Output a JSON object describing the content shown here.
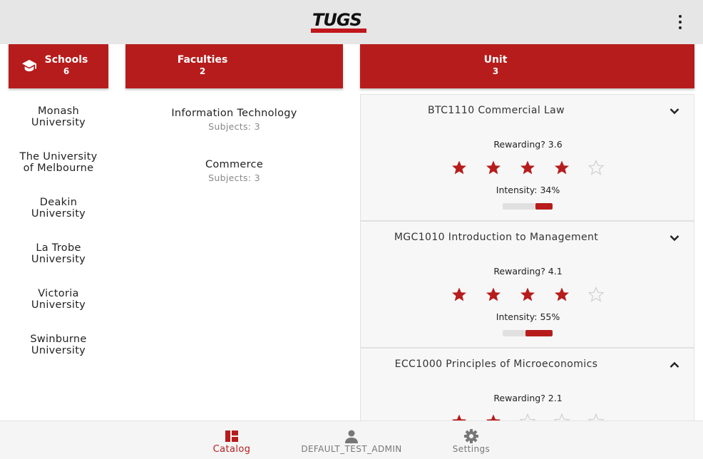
{
  "app": {
    "logo_text": "TUGS",
    "brand_color": "#b71c1c"
  },
  "header": {
    "menu_icon": "more-vertical-icon"
  },
  "columns": {
    "schools": {
      "title": "Schools",
      "count": "6",
      "icon": "graduation-cap-icon"
    },
    "faculties": {
      "title": "Faculties",
      "count": "2"
    },
    "unit": {
      "title": "Unit",
      "count": "3"
    }
  },
  "schools": [
    {
      "line1": "Monash",
      "line2": "University"
    },
    {
      "line1": "The University",
      "line2": "of Melbourne"
    },
    {
      "line1": "Deakin",
      "line2": "University"
    },
    {
      "line1": "La Trobe",
      "line2": "University"
    },
    {
      "line1": "Victoria",
      "line2": "University"
    },
    {
      "line1": "Swinburne",
      "line2": "University"
    }
  ],
  "faculties": [
    {
      "name": "Information Technology",
      "subjects": "Subjects: 3"
    },
    {
      "name": "Commerce",
      "subjects": "Subjects: 3"
    }
  ],
  "units": [
    {
      "title": "BTC1110 Commercial Law",
      "expanded": false,
      "rewarding_text": "Rewarding? 3.6",
      "rewarding": 3.6,
      "stars_filled": 4,
      "stars_total": 5,
      "intensity_text": "Intensity: 34%",
      "intensity": 0.34
    },
    {
      "title": "MGC1010 Introduction to Management",
      "expanded": false,
      "rewarding_text": "Rewarding? 4.1",
      "rewarding": 4.1,
      "stars_filled": 4,
      "stars_total": 5,
      "intensity_text": "Intensity: 55%",
      "intensity": 0.55
    },
    {
      "title": "ECC1000 Principles of Microeconomics",
      "expanded": true,
      "rewarding_text": "Rewarding? 2.1",
      "rewarding": 2.1,
      "stars_filled": 2,
      "stars_total": 5,
      "intensity_text": "",
      "intensity": null
    }
  ],
  "bottom_nav": [
    {
      "label": "Catalog",
      "icon": "dashboard-icon",
      "active": true
    },
    {
      "label": "DEFAULT_TEST_ADMIN",
      "icon": "person-icon",
      "active": false
    },
    {
      "label": "Settings",
      "icon": "gear-icon",
      "active": false
    }
  ]
}
